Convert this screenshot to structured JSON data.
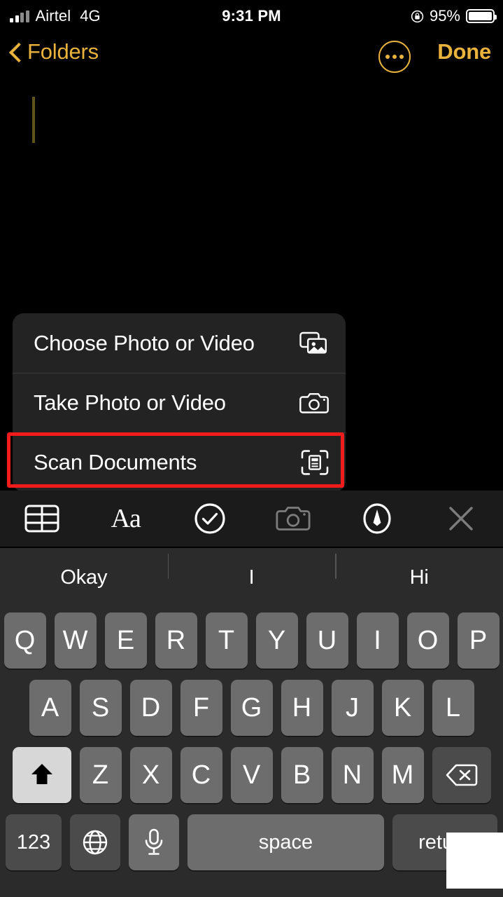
{
  "status_bar": {
    "carrier": "Airtel",
    "network": "4G",
    "time": "9:31 PM",
    "battery_percent": "95%",
    "rotation_lock_icon": "rotation-lock-icon",
    "battery_icon": "battery-full-icon",
    "signal_icon": "signal-bars-icon"
  },
  "nav_bar": {
    "back_label": "Folders",
    "back_icon": "chevron-left-icon",
    "more_icon": "ellipsis-circle-icon",
    "done_label": "Done",
    "accent_color": "#e8b23c"
  },
  "note": {
    "body_text": "",
    "caret_visible": true
  },
  "action_menu": {
    "items": [
      {
        "label": "Choose Photo or Video",
        "icon": "photo-stack-icon"
      },
      {
        "label": "Take Photo or Video",
        "icon": "camera-icon"
      },
      {
        "label": "Scan Documents",
        "icon": "document-scanner-icon"
      }
    ],
    "highlighted_index": 2,
    "highlight_color": "#f01b1b",
    "background_color": "#232323"
  },
  "format_toolbar": {
    "buttons": [
      {
        "name": "table-icon",
        "label": "",
        "dimmed": false
      },
      {
        "name": "text-format-icon",
        "label": "Aa",
        "dimmed": false
      },
      {
        "name": "checklist-icon",
        "label": "",
        "dimmed": false
      },
      {
        "name": "camera-icon",
        "label": "",
        "dimmed": true
      },
      {
        "name": "markup-pen-icon",
        "label": "",
        "dimmed": false
      },
      {
        "name": "close-icon",
        "label": "",
        "dimmed": true
      }
    ]
  },
  "predictive_bar": {
    "suggestions": [
      "Okay",
      "I",
      "Hi"
    ]
  },
  "keyboard": {
    "row1": [
      "Q",
      "W",
      "E",
      "R",
      "T",
      "Y",
      "U",
      "I",
      "O",
      "P"
    ],
    "row2": [
      "A",
      "S",
      "D",
      "F",
      "G",
      "H",
      "J",
      "K",
      "L"
    ],
    "row3_letters": [
      "Z",
      "X",
      "C",
      "V",
      "B",
      "N",
      "M"
    ],
    "shift_icon": "shift-up-icon",
    "shift_active": true,
    "delete_icon": "delete-backward-icon",
    "numbers_label": "123",
    "globe_icon": "globe-icon",
    "mic_icon": "microphone-icon",
    "space_label": "space",
    "return_label": "return",
    "key_color": "#6d6d6d",
    "special_key_color": "#4b4b4b",
    "shift_active_color": "#d7d7d7",
    "background_color": "#2b2b2b"
  }
}
